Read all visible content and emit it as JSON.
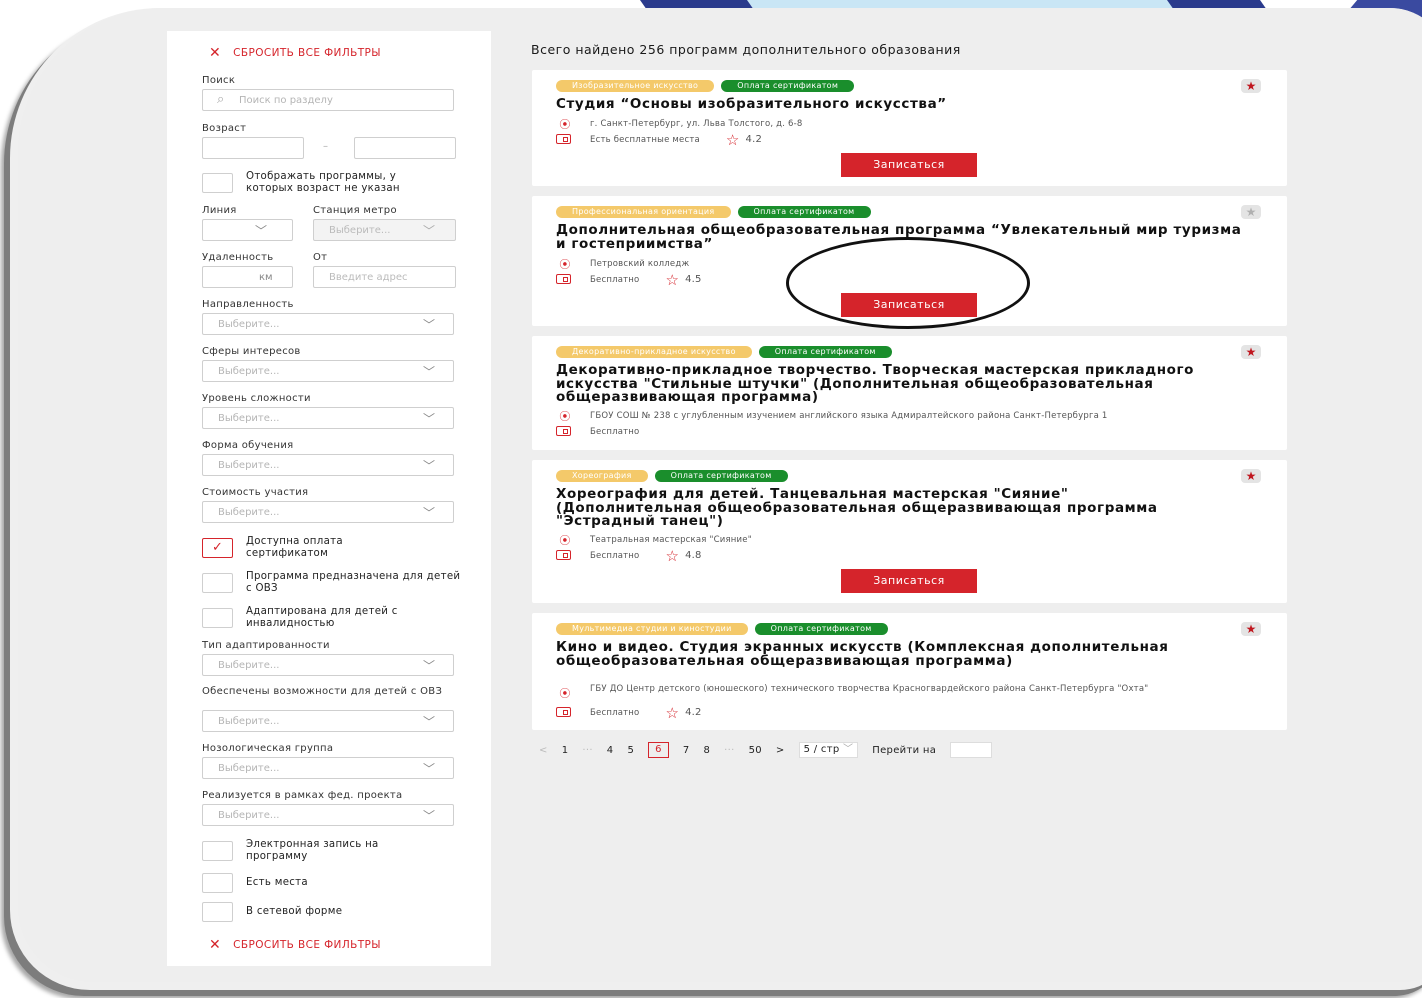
{
  "sidebar": {
    "reset_label": "СБРОСИТЬ ВСЕ ФИЛЬТРЫ",
    "search_label": "Поиск",
    "search_placeholder": "Поиск по разделу",
    "age_label": "Возраст",
    "age_dash": "–",
    "show_no_age": "Отображать программы, у которых возраст не указан",
    "line_label": "Линия",
    "metro_label": "Станция метро",
    "metro_placeholder": "Выберите...",
    "distance_label": "Удаленность",
    "distance_unit": "км",
    "from_label": "От",
    "address_placeholder": "Введите адрес",
    "selects": [
      {
        "label": "Направленность",
        "placeholder": "Выберите..."
      },
      {
        "label": "Сферы интересов",
        "placeholder": "Выберите..."
      },
      {
        "label": "Уровень сложности",
        "placeholder": "Выберите..."
      },
      {
        "label": "Форма обучения",
        "placeholder": "Выберите..."
      },
      {
        "label": "Стоимость участия",
        "placeholder": "Выберите..."
      }
    ],
    "checks1": [
      {
        "label": "Доступна оплата сертификатом",
        "checked": true
      },
      {
        "label": "Программа предназначена для детей с ОВЗ",
        "checked": false
      },
      {
        "label": "Адаптирована для детей с инвалидностью",
        "checked": false
      }
    ],
    "selects2": [
      {
        "label": "Тип адаптированности",
        "placeholder": "Выберите..."
      },
      {
        "label": "Обеспечены возможности для детей с ОВЗ",
        "placeholder": "Выберите..."
      },
      {
        "label": "Нозологическая группа",
        "placeholder": "Выберите..."
      },
      {
        "label": "Реализуется в рамках фед. проекта",
        "placeholder": "Выберите..."
      }
    ],
    "checks2": [
      {
        "label": "Электронная запись на программу",
        "checked": false
      },
      {
        "label": "Есть места",
        "checked": false
      },
      {
        "label": "В сетевой форме",
        "checked": false
      }
    ]
  },
  "main": {
    "total_text": "Всего найдено 256 программ дополнительного образования",
    "enroll_label": "Записаться",
    "cards": [
      {
        "tag1": "Изобразительное искусство",
        "tag2": "Оплата сертификатом",
        "title": "Студия “Основы изобразительного искусства”",
        "address": "г. Санкт-Петербург, ул. Льва Толстого, д. 6-8",
        "price": "Есть бесплатные места",
        "rating": "4.2",
        "favorite": true
      },
      {
        "tag1": "Профессиональная ориентация",
        "tag2": "Оплата сертификатом",
        "title": "Дополнительная общеобразовательная программа “Увлекательный мир туризма и гостеприимства”",
        "address": "Петровский колледж",
        "price": "Бесплатно",
        "rating": "4.5",
        "favorite": false
      },
      {
        "tag1": "Декоративно-прикладное искусство",
        "tag2": "Оплата сертификатом",
        "title": "Декоративно-прикладное творчество. Творческая мастерская прикладного искусства \"Стильные штучки\" (Дополнительная общеобразовательная общеразвивающая программа)",
        "address": "ГБОУ СОШ № 238 с углубленным изучением английского языка Адмиралтейского района Санкт-Петербурга 1",
        "price": "Бесплатно",
        "rating": "",
        "favorite": true
      },
      {
        "tag1": "Хореография",
        "tag2": "Оплата сертификатом",
        "title": "Хореография для детей. Танцевальная мастерская \"Сияние\" (Дополнительная общеобразовательная общеразвивающая программа \"Эстрадный танец\")",
        "address": "Театральная мастерская \"Сияние\"",
        "price": "Бесплатно",
        "rating": "4.8",
        "favorite": true
      },
      {
        "tag1": "Мультимедиа студии и киностудии",
        "tag2": "Оплата сертификатом",
        "title": "Кино и видео. Студия экранных искусств (Комплексная дополнительная общеобразовательная общеразвивающая программа)",
        "address": "ГБУ ДО Центр детского (юношеского) технического творчества Красногвардейского района Санкт-Петербурга \"Охта\"",
        "price": "Бесплатно",
        "rating": "4.2",
        "favorite": true
      }
    ]
  },
  "pagination": {
    "prev": "<",
    "p1": "1",
    "dots": "···",
    "p4": "4",
    "p5": "5",
    "current": "6",
    "p7": "7",
    "p8": "8",
    "dots2": "···",
    "last": "50",
    "next": ">",
    "page_size": "5 / стр",
    "goto_label": "Перейти на"
  },
  "colors": {
    "accent": "#d5242b",
    "tag_yellow": "#f4c96a",
    "tag_green": "#1a8e2c"
  }
}
